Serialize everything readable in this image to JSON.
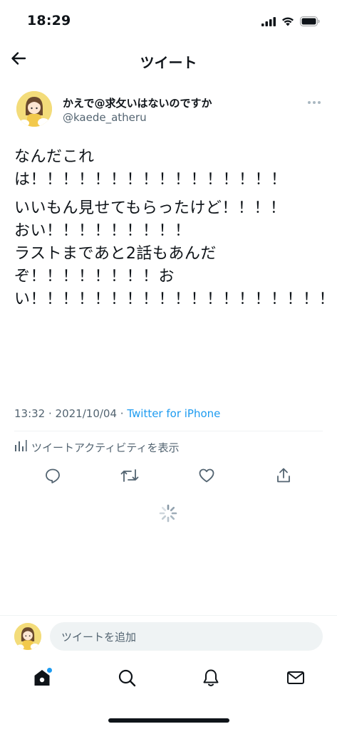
{
  "status_bar": {
    "time": "18:29"
  },
  "header": {
    "title": "ツイート"
  },
  "author": {
    "name": "かえで@求攵いはないのですか",
    "handle": "@kaede_atheru"
  },
  "tweet": {
    "paragraphs": [
      "なんだこれは！！！！！！！！！！！！！！！！",
      "いいもん見せてもらったけど！！！！\nおい！！！！！！！！！\nラストまであと2話もあんだぞ！！！！！！！！おい！！！！！！！！！！！！！！！！！！！！！！！！！！！！！！！！！！！！！！！！！！！！！！！！！！！！！！！！"
    ]
  },
  "meta": {
    "time": "13:32",
    "separator": " · ",
    "date": "2021/10/04",
    "source": "Twitter for iPhone"
  },
  "activity": {
    "label": "ツイートアクティビティを表示"
  },
  "composer": {
    "placeholder": "ツイートを追加"
  },
  "colors": {
    "accent": "#1d9bf0",
    "text": "#0f1419",
    "secondary": "#536471",
    "divider": "#eff3f4"
  },
  "icons": {
    "back": "arrow-left-icon",
    "more": "more-dots-icon",
    "reply": "reply-icon",
    "retweet": "retweet-icon",
    "like": "heart-icon",
    "share": "share-icon",
    "activity": "bar-chart-icon",
    "home": "home-icon",
    "search": "search-icon",
    "notifications": "bell-icon",
    "messages": "envelope-icon"
  }
}
